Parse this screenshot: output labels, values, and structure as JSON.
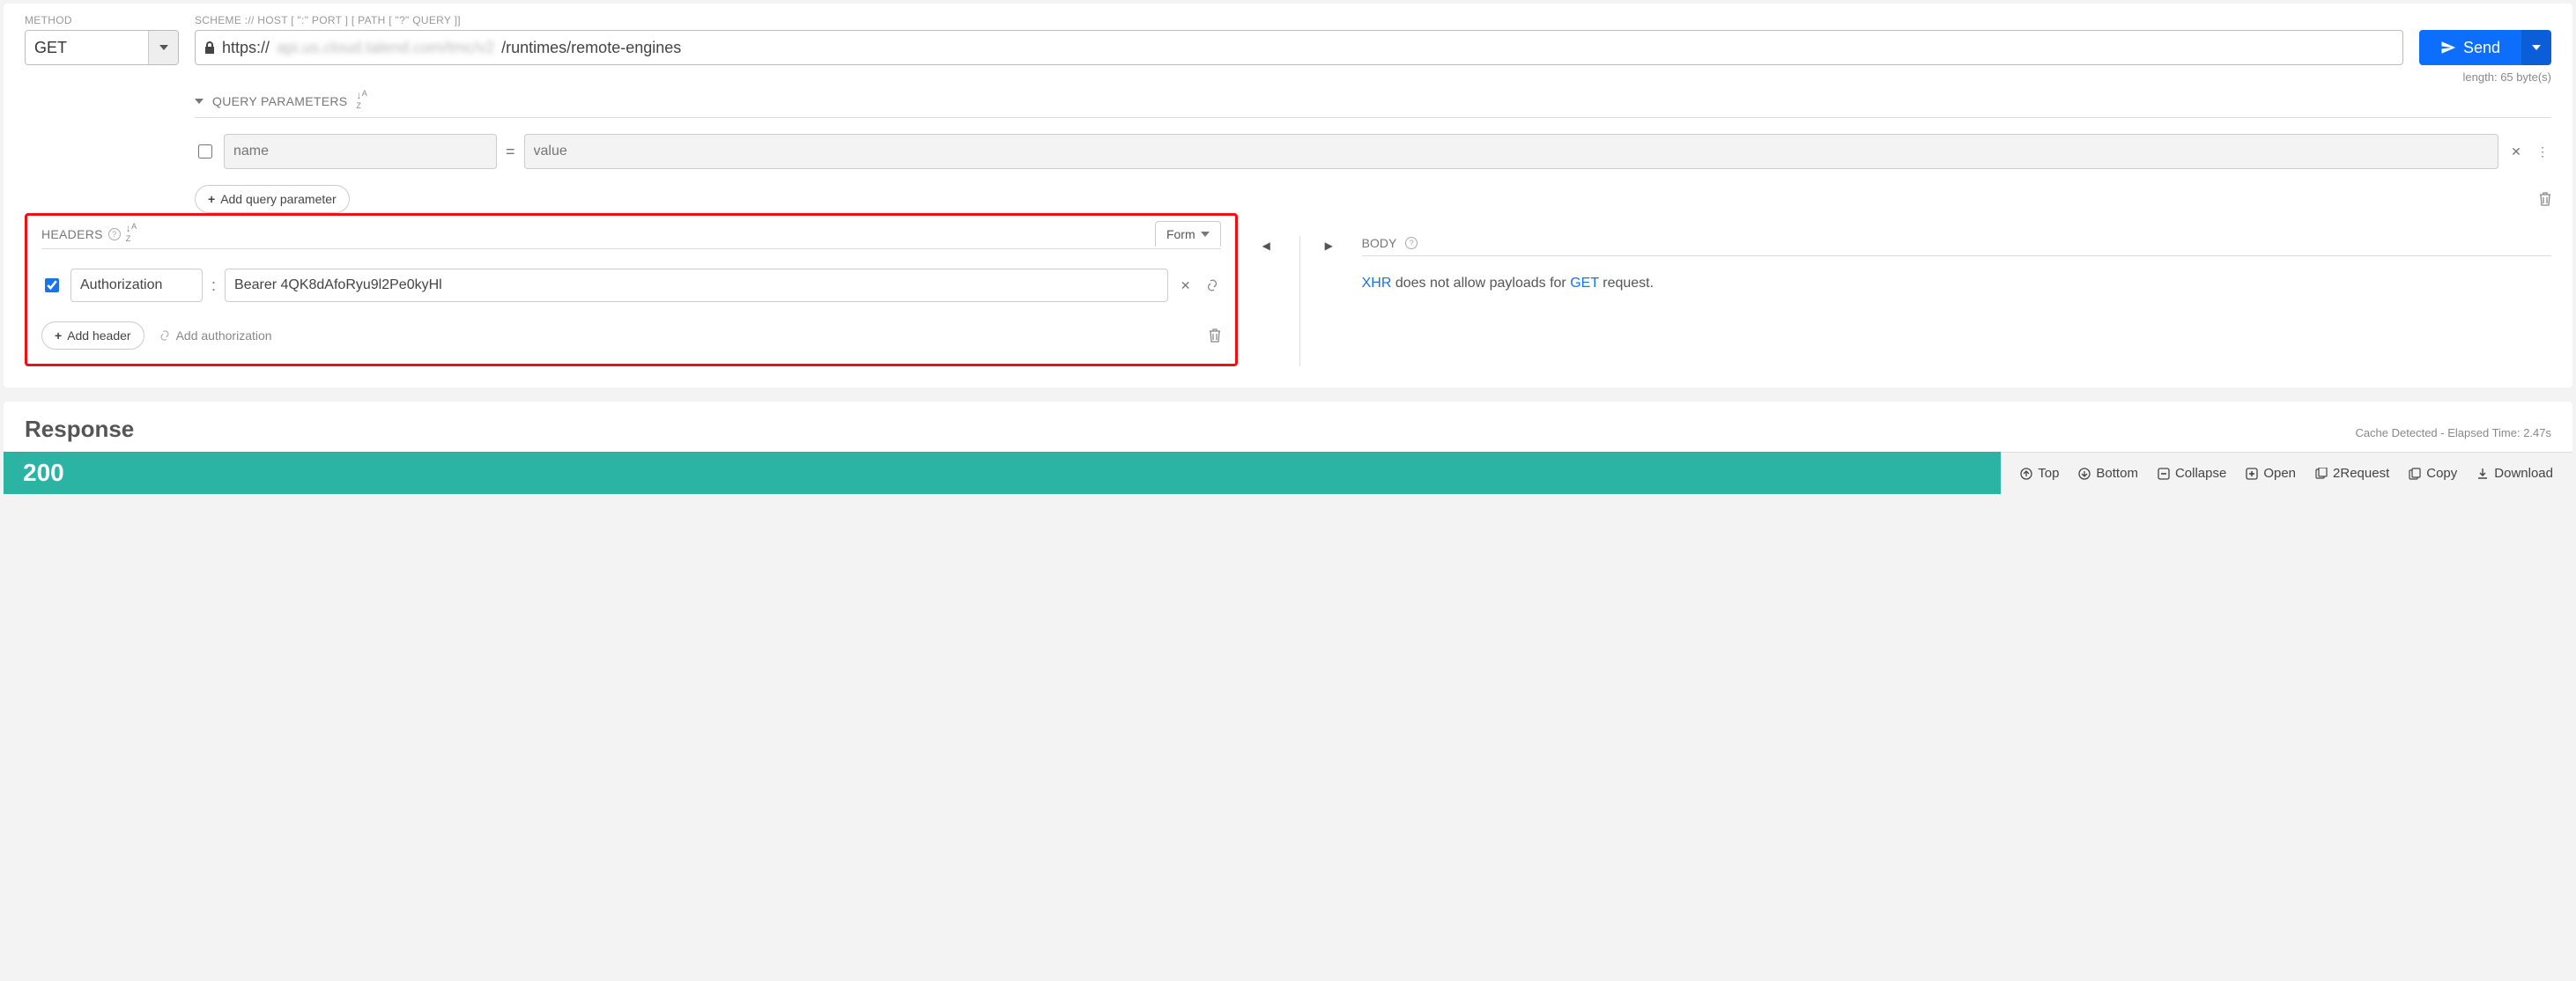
{
  "method": {
    "label": "METHOD",
    "value": "GET"
  },
  "url": {
    "label": "SCHEME :// HOST [ \":\" PORT ] [ PATH [ \"?\" QUERY ]]",
    "scheme": "https://",
    "host_blur": "api.us.cloud.talend.com/tmc/v2",
    "path": "/runtimes/remote-engines",
    "length": "length: 65 byte(s)"
  },
  "send": {
    "label": "Send"
  },
  "query_params": {
    "title": "QUERY PARAMETERS",
    "row": {
      "name_placeholder": "name",
      "value_placeholder": "value"
    },
    "add_label": "Add query parameter"
  },
  "headers": {
    "title": "HEADERS",
    "form_label": "Form",
    "row": {
      "checked": true,
      "name": "Authorization",
      "value": "Bearer 4QK8dAfoRyu9l2Pe0kyHl"
    },
    "add_label": "Add header",
    "add_auth_label": "Add authorization"
  },
  "body": {
    "title": "BODY",
    "msg_pre": "XHR",
    "msg_mid": " does not allow payloads for ",
    "msg_method": "GET",
    "msg_post": " request."
  },
  "response": {
    "title": "Response",
    "meta": "Cache Detected - Elapsed Time: 2.47s",
    "status": "200",
    "actions": {
      "top": "Top",
      "bottom": "Bottom",
      "collapse": "Collapse",
      "open": "Open",
      "request": "2Request",
      "copy": "Copy",
      "download": "Download"
    }
  }
}
